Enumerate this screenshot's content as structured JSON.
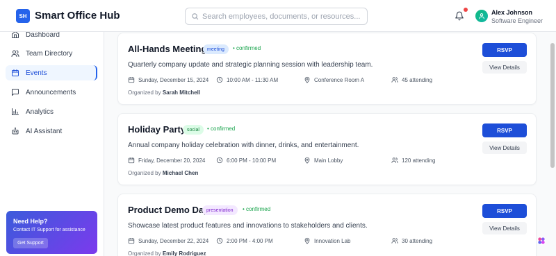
{
  "header": {
    "logo": "SH",
    "title": "Smart Office Hub",
    "search_placeholder": "Search employees, documents, or resources...",
    "user": {
      "name": "Alex Johnson",
      "role": "Software Engineer"
    }
  },
  "sidebar": {
    "items": [
      {
        "label": "Dashboard",
        "icon": "home-icon",
        "active": false
      },
      {
        "label": "Team Directory",
        "icon": "users-icon",
        "active": false
      },
      {
        "label": "Events",
        "icon": "calendar-icon",
        "active": true
      },
      {
        "label": "Announcements",
        "icon": "message-icon",
        "active": false
      },
      {
        "label": "Analytics",
        "icon": "bar-chart-icon",
        "active": false
      },
      {
        "label": "AI Assistant",
        "icon": "bot-icon",
        "active": false
      }
    ],
    "help": {
      "title": "Need Help?",
      "text": "Contact IT Support for assistance",
      "button": "Get Support"
    }
  },
  "events": [
    {
      "title": "All-Hands Meeting",
      "tag": "meeting",
      "status": "confirmed",
      "description": "Quarterly company update and strategic planning session with leadership team.",
      "date": "Sunday, December 15, 2024",
      "time": "10:00 AM - 11:30 AM",
      "location": "Conference Room A",
      "attending": "45 attending",
      "organized_by_label": "Organized by",
      "organizer": "Sarah Mitchell",
      "rsvp": "RSVP",
      "details": "View Details"
    },
    {
      "title": "Holiday Party",
      "tag": "social",
      "status": "confirmed",
      "description": "Annual company holiday celebration with dinner, drinks, and entertainment.",
      "date": "Friday, December 20, 2024",
      "time": "6:00 PM - 10:00 PM",
      "location": "Main Lobby",
      "attending": "120 attending",
      "organized_by_label": "Organized by",
      "organizer": "Michael Chen",
      "rsvp": "RSVP",
      "details": "View Details"
    },
    {
      "title": "Product Demo Day",
      "tag": "presentation",
      "status": "confirmed",
      "description": "Showcase latest product features and innovations to stakeholders and clients.",
      "date": "Sunday, December 22, 2024",
      "time": "2:00 PM - 4:00 PM",
      "location": "Innovation Lab",
      "attending": "30 attending",
      "organized_by_label": "Organized by",
      "organizer": "Emily Rodriguez",
      "rsvp": "RSVP",
      "details": "View Details"
    }
  ],
  "colors": {
    "primary": "#1d4ed8",
    "confirmed": "#16a34a",
    "notification": "#ef4444"
  }
}
